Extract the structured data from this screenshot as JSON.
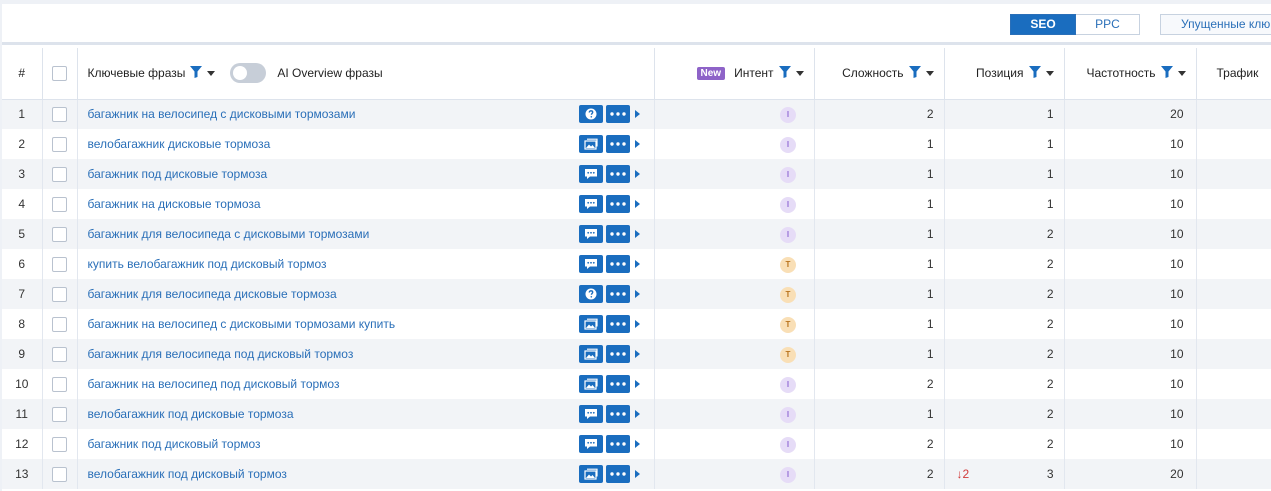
{
  "mode_tabs": {
    "seo": "SEO",
    "ppc": "PPC"
  },
  "missed_button": "Упущенные клю",
  "columns": {
    "num": "#",
    "keywords": "Ключевые фразы",
    "ai_overview": "AI Overview фразы",
    "new_badge": "New",
    "intent": "Интент",
    "difficulty": "Сложность",
    "position": "Позиция",
    "volume": "Частотность",
    "traffic": "Трафик"
  },
  "colors": {
    "accent": "#1a6dbf",
    "link": "#2a6fb8",
    "intent_I": "#e6dcf7",
    "intent_T": "#f9dfb6",
    "delta_down": "#d13b3b"
  },
  "rows": [
    {
      "n": "1",
      "kw": "багажник на велосипед с дисковыми тормозами",
      "serp_icon": "question-icon",
      "intent": "I",
      "difficulty": "2",
      "delta": "",
      "position": "1",
      "volume": "20"
    },
    {
      "n": "2",
      "kw": "велобагажник дисковые тормоза",
      "serp_icon": "image-pack-icon",
      "intent": "I",
      "difficulty": "1",
      "delta": "",
      "position": "1",
      "volume": "10"
    },
    {
      "n": "3",
      "kw": "багажник под дисковые тормоза",
      "serp_icon": "reviews-icon",
      "intent": "I",
      "difficulty": "1",
      "delta": "",
      "position": "1",
      "volume": "10"
    },
    {
      "n": "4",
      "kw": "багажник на дисковые тормоза",
      "serp_icon": "reviews-icon",
      "intent": "I",
      "difficulty": "1",
      "delta": "",
      "position": "1",
      "volume": "10"
    },
    {
      "n": "5",
      "kw": "багажник для велосипеда с дисковыми тормозами",
      "serp_icon": "reviews-icon",
      "intent": "I",
      "difficulty": "1",
      "delta": "",
      "position": "2",
      "volume": "10"
    },
    {
      "n": "6",
      "kw": "купить велобагажник под дисковый тормоз",
      "serp_icon": "reviews-icon",
      "intent": "T",
      "difficulty": "1",
      "delta": "",
      "position": "2",
      "volume": "10"
    },
    {
      "n": "7",
      "kw": "багажник для велосипеда дисковые тормоза",
      "serp_icon": "question-icon",
      "intent": "T",
      "difficulty": "1",
      "delta": "",
      "position": "2",
      "volume": "10"
    },
    {
      "n": "8",
      "kw": "багажник на велосипед с дисковыми тормозами купить",
      "serp_icon": "image-pack-icon",
      "intent": "T",
      "difficulty": "1",
      "delta": "",
      "position": "2",
      "volume": "10"
    },
    {
      "n": "9",
      "kw": "багажник для велосипеда под дисковый тормоз",
      "serp_icon": "image-pack-icon",
      "intent": "T",
      "difficulty": "1",
      "delta": "",
      "position": "2",
      "volume": "10"
    },
    {
      "n": "10",
      "kw": "багажник на велосипед под дисковый тормоз",
      "serp_icon": "image-pack-icon",
      "intent": "I",
      "difficulty": "2",
      "delta": "",
      "position": "2",
      "volume": "10"
    },
    {
      "n": "11",
      "kw": "велобагажник под дисковые тормоза",
      "serp_icon": "reviews-icon",
      "intent": "I",
      "difficulty": "1",
      "delta": "",
      "position": "2",
      "volume": "10"
    },
    {
      "n": "12",
      "kw": "багажник под дисковый тормоз",
      "serp_icon": "reviews-icon",
      "intent": "I",
      "difficulty": "2",
      "delta": "",
      "position": "2",
      "volume": "10"
    },
    {
      "n": "13",
      "kw": "велобагажник под дисковый тормоз",
      "serp_icon": "image-pack-icon",
      "intent": "I",
      "difficulty": "2",
      "delta": "↓2",
      "position": "3",
      "volume": "20"
    }
  ]
}
